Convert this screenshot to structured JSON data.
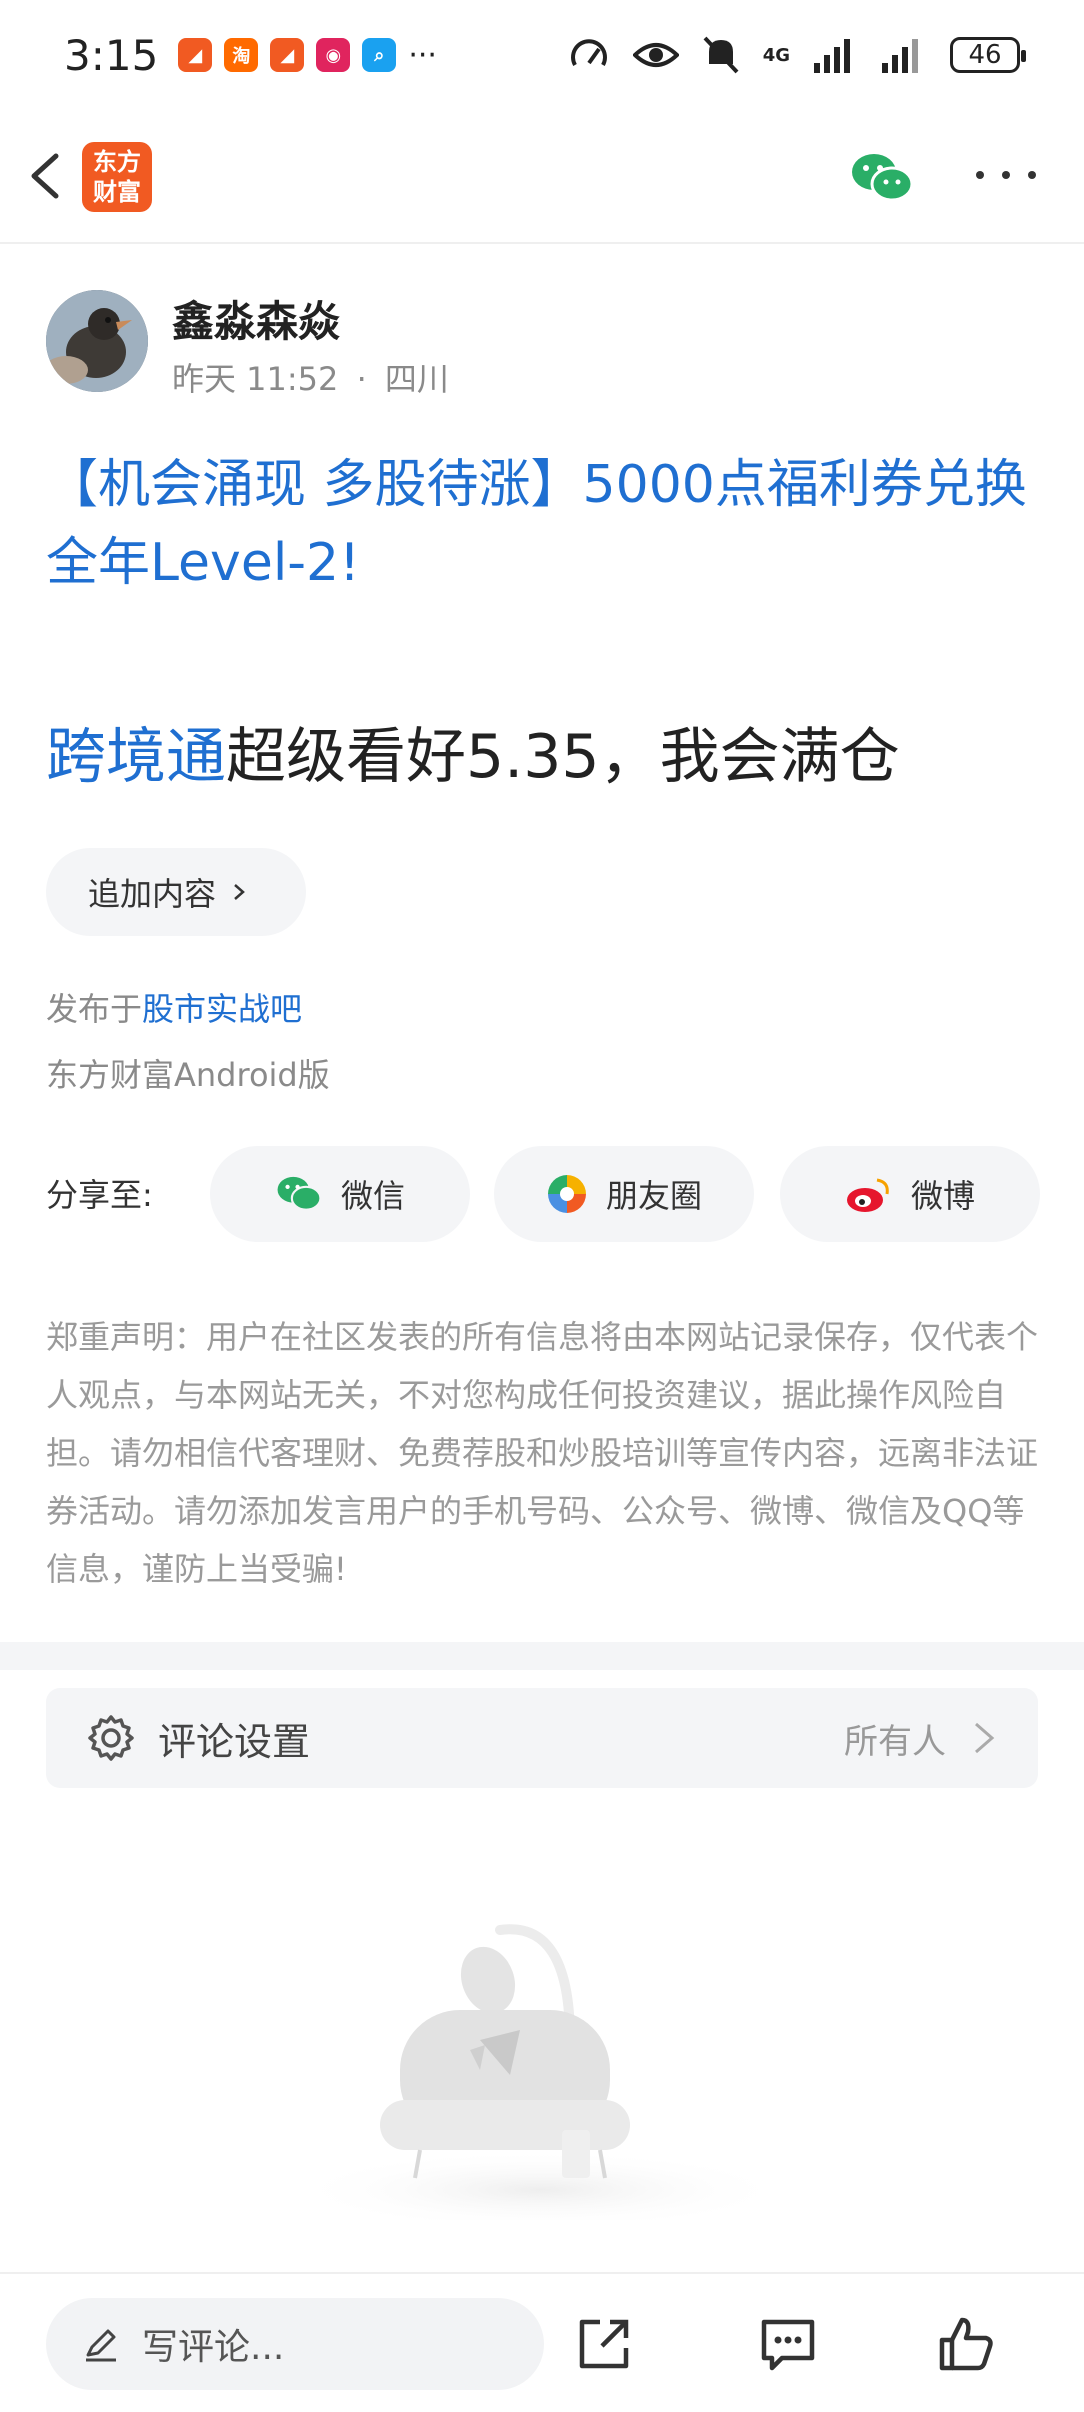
{
  "status_bar": {
    "time": "3:15",
    "dots": "···",
    "network": "4G",
    "battery": "46"
  },
  "header": {
    "logo_text": "东方\n财富"
  },
  "post": {
    "author": "鑫淼森焱",
    "time": "昨天 11:52",
    "location": "四川",
    "meta_separator": "·",
    "headline": "【机会涌现 多股待涨】5000点福利券兑换全年Level-2!",
    "body_link": "跨境通",
    "body_rest": "超级看好5.35，我会满仓",
    "append_label": "追加内容",
    "published_prefix": "发布于",
    "published_bar": "股市实战吧",
    "client": "东方财富Android版"
  },
  "share": {
    "label": "分享至:",
    "wechat": "微信",
    "moments": "朋友圈",
    "weibo": "微博"
  },
  "disclaimer": "郑重声明：用户在社区发表的所有信息将由本网站记录保存，仅代表个人观点，与本网站无关，不对您构成任何投资建议，据此操作风险自担。请勿相信代客理财、免费荐股和炒股培训等宣传内容，远离非法证券活动。请勿添加发言用户的手机号码、公众号、微博、微信及QQ等信息，谨防上当受骗!",
  "comment_settings": {
    "label": "评论设置",
    "value": "所有人"
  },
  "bottom_bar": {
    "input_placeholder": "写评论..."
  },
  "colors": {
    "accent_blue": "#1f6fd1",
    "brand_orange": "#f15a22",
    "wechat_green": "#2aae67",
    "weibo_red": "#e6162d"
  }
}
